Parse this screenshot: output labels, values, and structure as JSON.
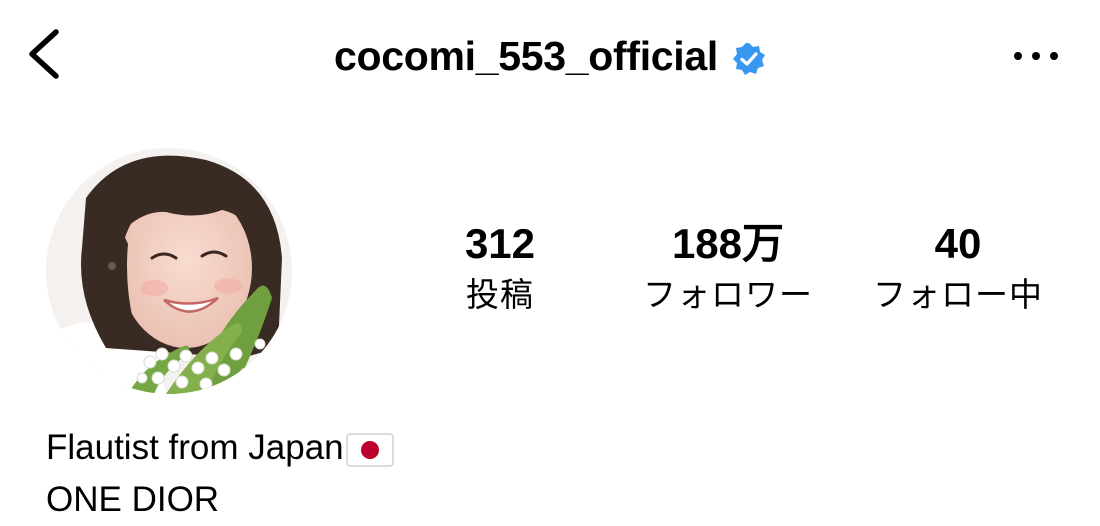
{
  "header": {
    "back_icon": "chevron-left-icon",
    "username": "cocomi_553_official",
    "verified_icon": "verified-badge-icon",
    "verified_color": "#3897f0",
    "more_icon": "more-horizontal-icon"
  },
  "profile": {
    "avatar": "profile-photo",
    "stats": {
      "posts": {
        "count": "312",
        "label": "投稿"
      },
      "followers": {
        "count": "188万",
        "label": "フォロワー"
      },
      "following": {
        "count": "40",
        "label": "フォロー中"
      }
    },
    "bio": {
      "line1": "Flautist from Japan",
      "line1_flag": "japan-flag-icon",
      "line2": "ONE DIOR"
    }
  }
}
